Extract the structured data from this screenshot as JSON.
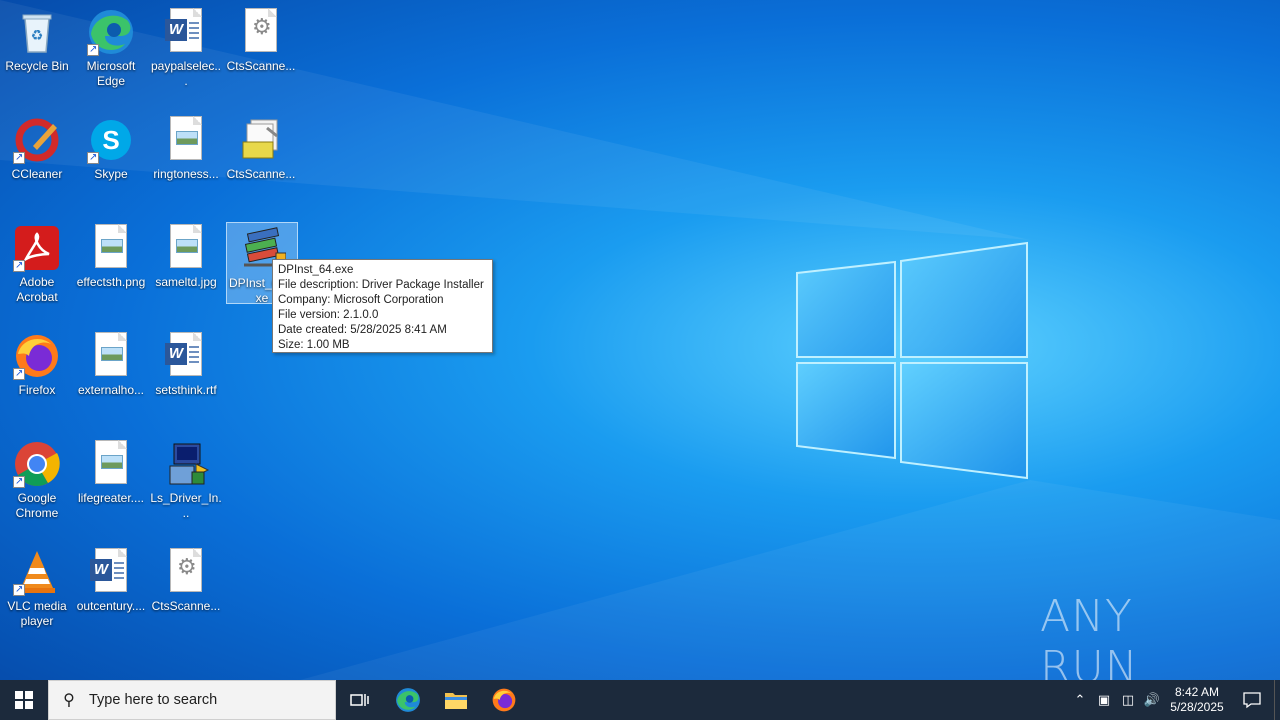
{
  "desktop": {
    "icons": [
      {
        "label": "Recycle Bin"
      },
      {
        "label": "Microsoft Edge"
      },
      {
        "label": "paypalselec..."
      },
      {
        "label": "CtsScanne..."
      },
      {
        "label": "CCleaner"
      },
      {
        "label": "Skype"
      },
      {
        "label": "ringtoness..."
      },
      {
        "label": "CtsScanne..."
      },
      {
        "label": "Adobe Acrobat"
      },
      {
        "label": "effectsth.png"
      },
      {
        "label": "sameltd.jpg"
      },
      {
        "label": "DPInst_64.exe"
      },
      {
        "label": "Firefox"
      },
      {
        "label": "externalho..."
      },
      {
        "label": "setsthink.rtf"
      },
      {
        "label": "Google Chrome"
      },
      {
        "label": "lifegreater...."
      },
      {
        "label": "Ls_Driver_In..."
      },
      {
        "label": "VLC media player"
      },
      {
        "label": "outcentury...."
      },
      {
        "label": "CtsScanne..."
      }
    ]
  },
  "tooltip": {
    "name": "DPInst_64.exe",
    "description": "File description: Driver Package Installer",
    "company": "Company: Microsoft Corporation",
    "version": "File version: 2.1.0.0",
    "created": "Date created: 5/28/2025 8:41 AM",
    "size": "Size: 1.00 MB"
  },
  "taskbar": {
    "search_placeholder": "Type here to search",
    "time": "8:42 AM",
    "date": "5/28/2025"
  },
  "watermark": "ANY RUN",
  "colors": {
    "taskbar": "#1c2a3c",
    "accent": "#0078d7"
  }
}
